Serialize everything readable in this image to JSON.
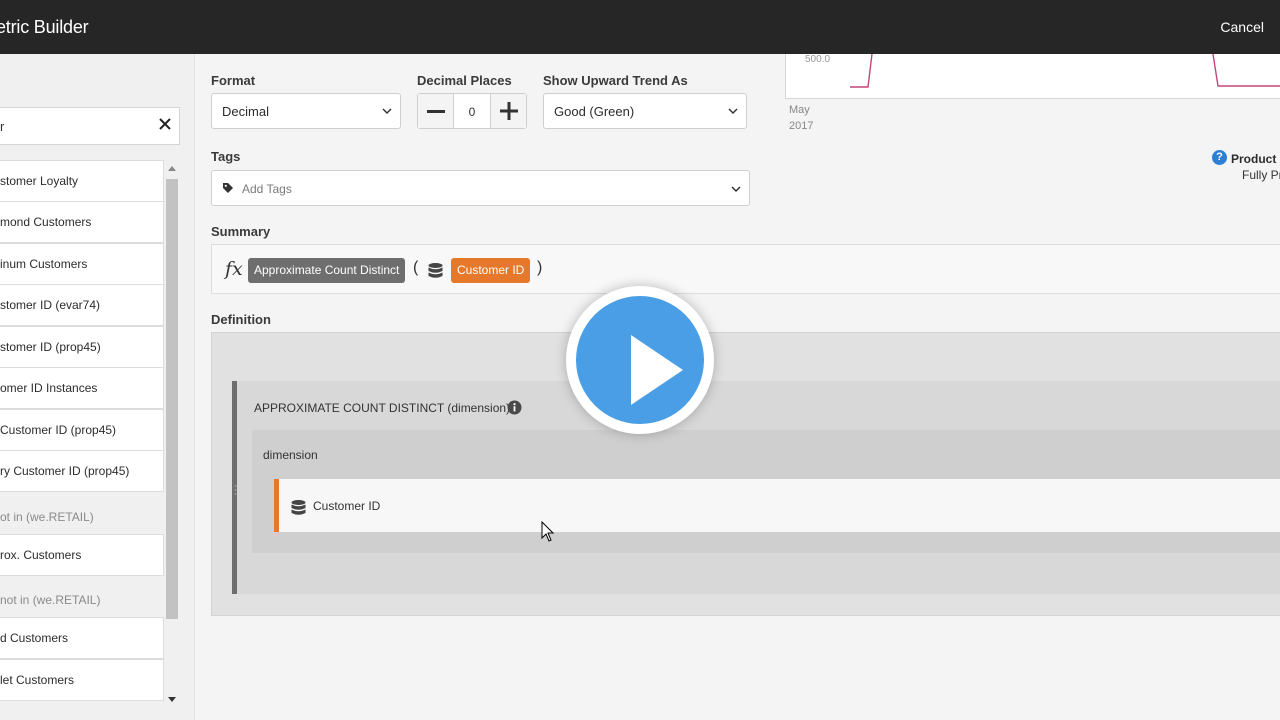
{
  "header": {
    "title": "etric Builder",
    "cancel_label": "Cancel"
  },
  "search": {
    "value": "r"
  },
  "sidebar": {
    "items": [
      {
        "label": "stomer Loyalty"
      },
      {
        "label": "mond Customers"
      },
      {
        "label": "inum Customers"
      },
      {
        "label": "stomer ID (evar74)"
      },
      {
        "label": "stomer ID (prop45)"
      },
      {
        "label": "omer ID Instances"
      },
      {
        "label": "Customer ID (prop45)"
      },
      {
        "label": "ry Customer ID (prop45)"
      },
      {
        "label": "rox. Customers"
      },
      {
        "label": "d Customers"
      },
      {
        "label": "let Customers"
      }
    ],
    "groups": [
      {
        "label": "ot in (we.RETAIL)"
      },
      {
        "label": "not in (we.RETAIL)"
      }
    ]
  },
  "format": {
    "label": "Format",
    "value": "Decimal"
  },
  "decimals": {
    "label": "Decimal Places",
    "value": "0"
  },
  "trend": {
    "label": "Show Upward Trend As",
    "value": "Good (Green)"
  },
  "tags": {
    "label": "Tags",
    "placeholder": "Add Tags"
  },
  "summary": {
    "label": "Summary",
    "fx": "fx",
    "function": "Approximate Count Distinct",
    "open_paren": "(",
    "dimension": "Customer ID",
    "close_paren": ")"
  },
  "definition": {
    "label": "Definition",
    "function_title": "APPROXIMATE COUNT DISTINCT (dimension)",
    "param_label": "dimension",
    "param_value": "Customer ID"
  },
  "chart": {
    "ytick": "500.0",
    "xlabel_month": "May",
    "xlabel_year": "2017"
  },
  "product": {
    "name": "Product C",
    "status": "Fully Pr"
  },
  "colors": {
    "accent_orange": "#e5782b",
    "function_gray": "#6e6e6e",
    "play_blue": "#4a9ee6",
    "help_blue": "#2d7fd6"
  }
}
